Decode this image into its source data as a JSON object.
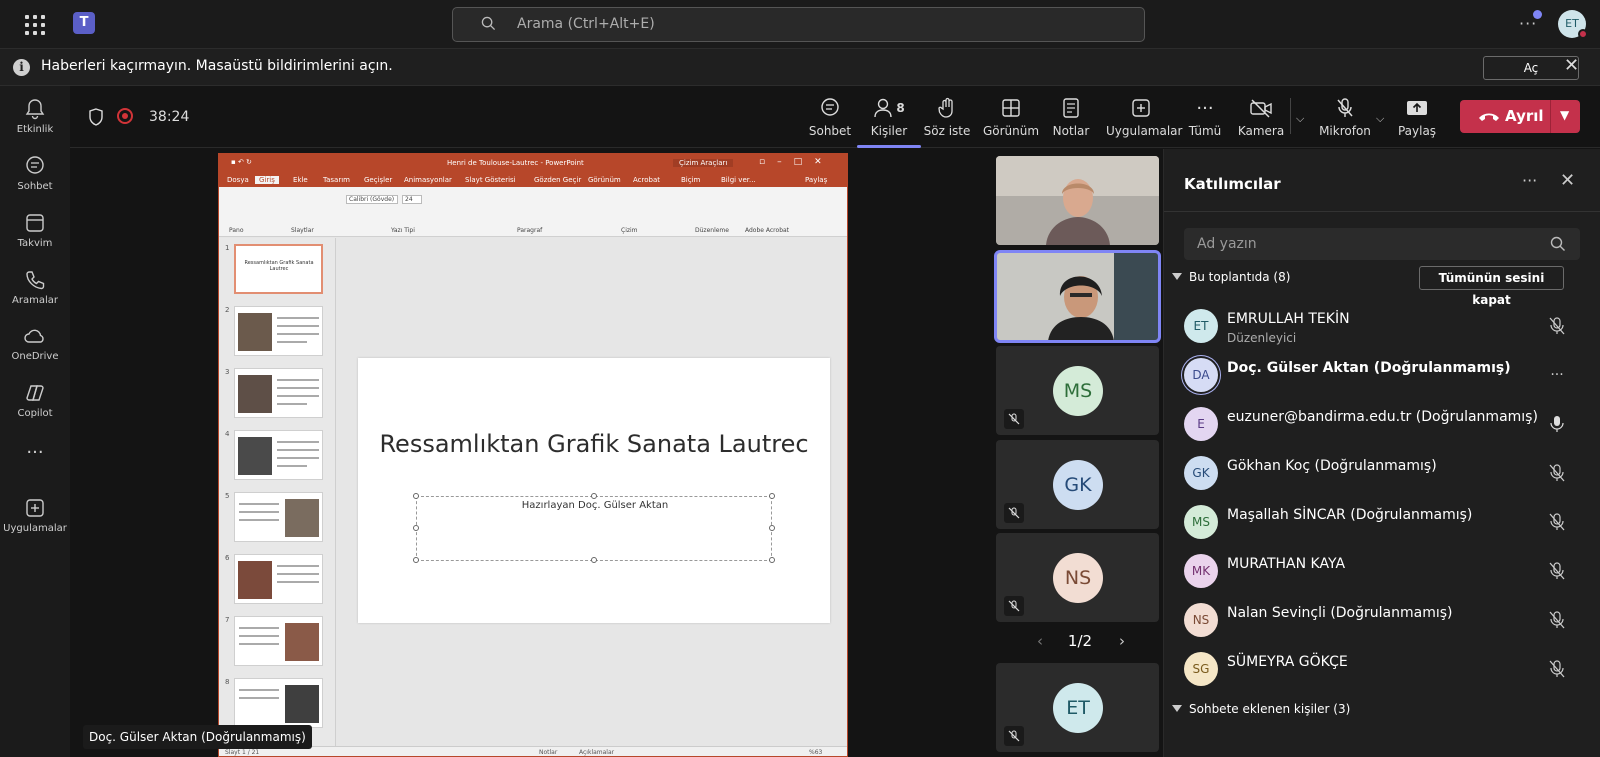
{
  "app": {
    "logo_letter": "T"
  },
  "search": {
    "placeholder": "Arama (Ctrl+Alt+E)"
  },
  "profile": {
    "initials": "ET"
  },
  "notification": {
    "message": "Haberleri kaçırmayın. Masaüstü bildirimlerini açın.",
    "action": "Aç"
  },
  "rail": [
    {
      "label": "Etkinlik",
      "icon": "bell-icon"
    },
    {
      "label": "Sohbet",
      "icon": "chat-icon"
    },
    {
      "label": "Takvim",
      "icon": "calendar-icon"
    },
    {
      "label": "Aramalar",
      "icon": "phone-icon"
    },
    {
      "label": "OneDrive",
      "icon": "cloud-icon"
    },
    {
      "label": "Copilot",
      "icon": "copilot-icon"
    },
    {
      "label": "",
      "icon": "more-icon"
    },
    {
      "label": "Uygulamalar",
      "icon": "add-app-icon"
    }
  ],
  "call": {
    "timer": "38:24",
    "controls": {
      "chat": "Sohbet",
      "people": "Kişiler",
      "people_count": "8",
      "raise": "Söz iste",
      "view": "Görünüm",
      "notes": "Notlar",
      "apps": "Uygulamalar",
      "more": "Tümü",
      "camera": "Kamera",
      "mic": "Mikrofon",
      "share": "Paylaş",
      "leave": "Ayrıl"
    }
  },
  "ppt": {
    "window_title": "Henri de Toulouse-Lautrec - PowerPoint",
    "context_tab": "Çizim Araçları",
    "tabs": [
      "Dosya",
      "Giriş",
      "Ekle",
      "Tasarım",
      "Geçişler",
      "Animasyonlar",
      "Slayt Gösterisi",
      "Gözden Geçir",
      "Görünüm",
      "Acrobat",
      "Biçim",
      "Bilgi ver...",
      "Paylaş"
    ],
    "groups": [
      "Pano",
      "Slaytlar",
      "Yazı Tipi",
      "Paragraf",
      "Çizim",
      "Düzenleme",
      "Adobe Acrobat"
    ],
    "font_name": "Calibri (Gövde)",
    "font_size": "24",
    "slide_numbers": [
      "1",
      "2",
      "3",
      "4",
      "5",
      "6",
      "7",
      "8"
    ],
    "thumb1_title": "Ressamlıktan Grafik Sanata Lautrec",
    "slide_title": "Ressamlıktan Grafik Sanata Lautrec",
    "slide_subtitle": "Hazırlayan Doç. Gülser Aktan",
    "status_left": "Slayt 1 / 21",
    "status_notes": "Notlar",
    "status_comments": "Açıklamalar",
    "zoom": "%63"
  },
  "caption": "Doç. Gülser Aktan (Doğrulanmamış)",
  "tiles": [
    {
      "initials": "",
      "type": "video"
    },
    {
      "initials": "",
      "type": "video",
      "speaking": true
    },
    {
      "initials": "MS",
      "bg": "#d4ebd8",
      "fg": "#2e6e3a"
    },
    {
      "initials": "GK",
      "bg": "#cdddf1",
      "fg": "#264b78"
    },
    {
      "initials": "NS",
      "bg": "#f2ddd3",
      "fg": "#7a4a35"
    },
    {
      "initials": "ET",
      "bg": "#cfe9ec",
      "fg": "#1f5a66"
    }
  ],
  "pager": "1/2",
  "participants_panel": {
    "title": "Katılımcılar",
    "search_placeholder": "Ad yazın",
    "in_meeting": "Bu toplantıda (8)",
    "mute_all": "Tümünün sesini kapat",
    "added": "Sohbete eklenen kişiler (3)",
    "people": [
      {
        "initials": "ET",
        "name": "EMRULLAH TEKİN",
        "role": "Düzenleyici",
        "status": "muted",
        "bg": "#cfe9ec",
        "fg": "#1f5a66"
      },
      {
        "initials": "DA",
        "name": "Doç. Gülser Aktan (Doğrulanmamış)",
        "role": "",
        "status": "more",
        "bg": "#d6dcf5",
        "fg": "#3a4a8c"
      },
      {
        "initials": "E",
        "name": "euzuner@bandirma.edu.tr (Doğrulanmamış)",
        "role": "",
        "status": "unmuted",
        "bg": "#e3d6f1",
        "fg": "#5a3a85"
      },
      {
        "initials": "GK",
        "name": "Gökhan Koç (Doğrulanmamış)",
        "role": "",
        "status": "muted",
        "bg": "#cdddf1",
        "fg": "#264b78"
      },
      {
        "initials": "MS",
        "name": "Maşallah SİNCAR (Doğrulanmamış)",
        "role": "",
        "status": "muted",
        "bg": "#d4ebd8",
        "fg": "#2e6e3a"
      },
      {
        "initials": "MK",
        "name": "MURATHAN KAYA",
        "role": "",
        "status": "muted",
        "bg": "#ead3ec",
        "fg": "#73306f"
      },
      {
        "initials": "NS",
        "name": "Nalan Sevinçli (Doğrulanmamış)",
        "role": "",
        "status": "muted",
        "bg": "#f2ddd3",
        "fg": "#7a4a35"
      },
      {
        "initials": "SG",
        "name": "SÜMEYRA GÖKÇE",
        "role": "",
        "status": "muted",
        "bg": "#f5e6c6",
        "fg": "#7a5a1c"
      }
    ]
  }
}
